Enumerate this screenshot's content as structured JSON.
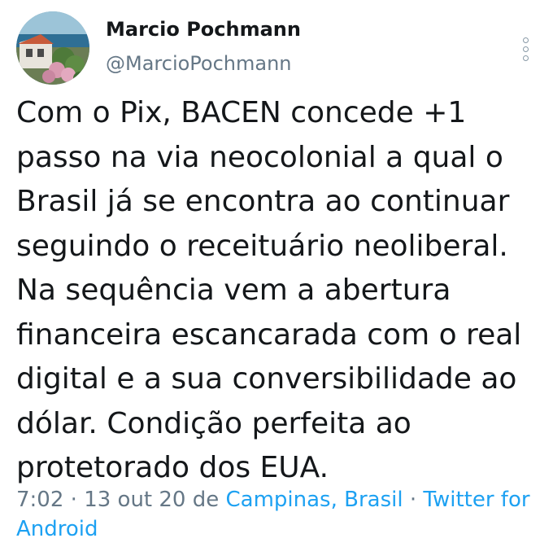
{
  "author": {
    "display_name": "Marcio Pochmann",
    "handle": "@MarcioPochmann"
  },
  "tweet": {
    "lines": [
      "Com o Pix, BACEN concede +1",
      "passo na via neocolonial a qual o",
      "Brasil já se encontra ao continuar",
      "seguindo o receituário neoliberal.",
      "Na sequência vem a abertura",
      "financeira escancarada com o real",
      "digital e a sua conversibilidade ao",
      "dólar. Condição perfeita ao",
      "protetorado dos EUA."
    ]
  },
  "meta": {
    "time": "7:02",
    "separator": " · ",
    "date": "13 out 20",
    "location_prefix": " de ",
    "location": "Campinas, Brasil",
    "client": "Twitter for Android"
  },
  "icons": {
    "more": "more-vertical-icon",
    "avatar": "profile-photo"
  },
  "colors": {
    "link": "#1da1f2",
    "secondary_text": "#657786",
    "primary_text": "#14171a"
  }
}
